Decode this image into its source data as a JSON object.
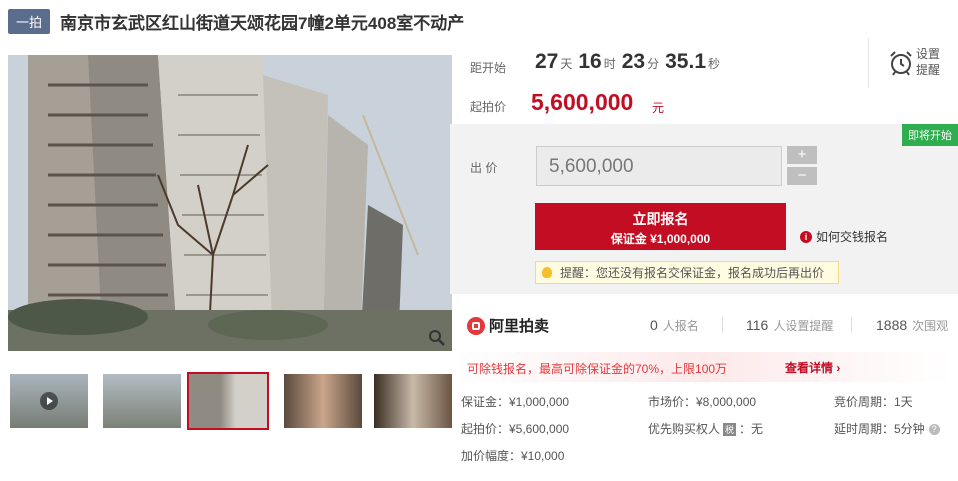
{
  "header": {
    "tag": "一拍",
    "title": "南京市玄武区红山街道天颂花园7幢2单元408室不动产"
  },
  "countdown": {
    "label": "距开始",
    "days": "27",
    "days_unit": "天",
    "hours": "16",
    "hours_unit": "时",
    "minutes": "23",
    "minutes_unit": "分",
    "seconds": "35.1",
    "seconds_unit": "秒"
  },
  "reminder": {
    "label": "设置提醒",
    "icon": "alarm-clock-icon"
  },
  "start_price": {
    "label": "起拍价",
    "value": "5,600,000",
    "unit": "元"
  },
  "bid": {
    "badge": "即将开始",
    "label": "出 价",
    "value": "5,600,000",
    "plus": "+",
    "minus": "−",
    "signup_title": "立即报名",
    "signup_deposit": "保证金 ¥1,000,000",
    "howto": "如何交钱报名",
    "tip": "提醒：您还没有报名交保证金，报名成功后再出价"
  },
  "platform": {
    "name": "阿里拍卖",
    "stats": [
      {
        "value": "0",
        "unit": "人报名"
      },
      {
        "value": "116",
        "unit": "人设置提醒"
      },
      {
        "value": "1888",
        "unit": "次围观"
      }
    ]
  },
  "promo": {
    "text": "可除钱报名，最高可除保证金的70%，上限100万",
    "link": "查看详情"
  },
  "details": {
    "deposit": "保证金：¥1,000,000",
    "start": "起拍价：¥5,600,000",
    "increment": "加价幅度：¥10,000",
    "market": "市场价：¥8,000,000",
    "priority": "优先购买权人",
    "priority_badge": "税",
    "priority_value": "：无",
    "cycle": "竞价周期：1天",
    "delay": "延时周期：5分钟"
  },
  "colors": {
    "accent": "#c30d23",
    "green_badge": "#2eae4f",
    "tag_bg": "#5b6d8c"
  }
}
